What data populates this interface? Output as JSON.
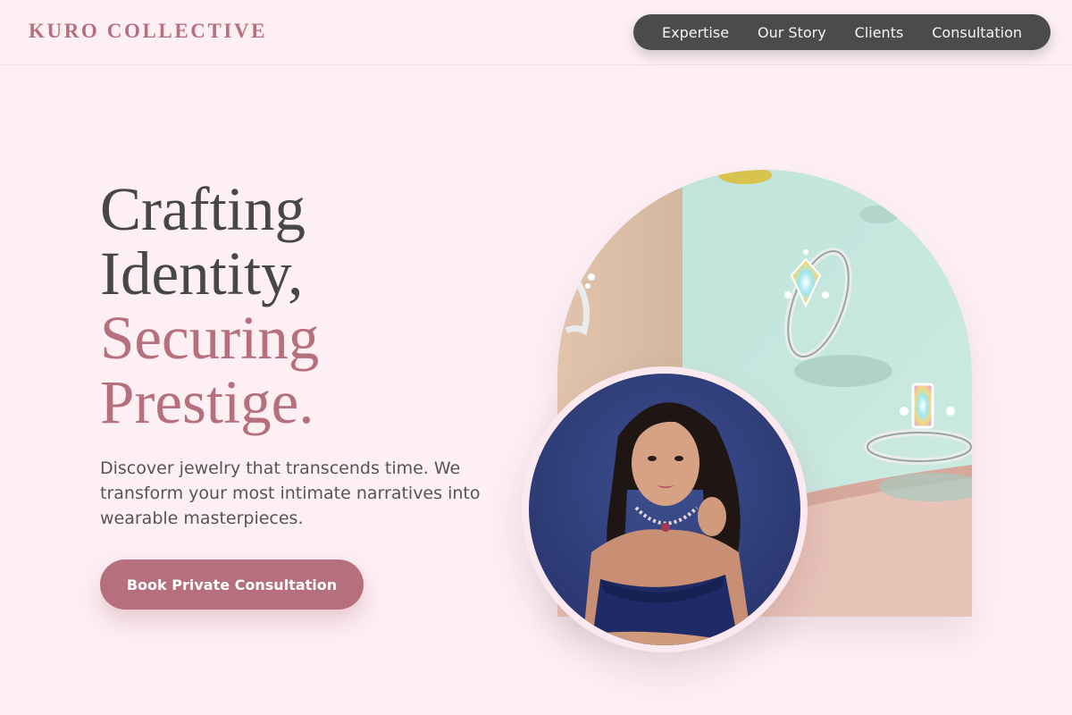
{
  "brand": {
    "logo_text": "KURO COLLECTIVE"
  },
  "nav": {
    "items": [
      {
        "label": "Expertise"
      },
      {
        "label": "Our Story"
      },
      {
        "label": "Clients"
      },
      {
        "label": "Consultation"
      }
    ]
  },
  "hero": {
    "headline_line1": "Crafting",
    "headline_line2": "Identity,",
    "headline_line3": "Securing",
    "headline_line4": "Prestige.",
    "subtext": "Discover jewelry that transcends time. We transform your most intimate narratives into wearable masterpieces.",
    "cta_label": "Book Private Consultation"
  },
  "media": {
    "arch_image": "rings-on-mint-display",
    "portrait_image": "woman-in-navy-dress-with-necklace"
  },
  "colors": {
    "background": "#fdeff4",
    "accent_rose": "#b56f7d",
    "text_dark": "#474747",
    "nav_bg": "#4b4b4b"
  }
}
